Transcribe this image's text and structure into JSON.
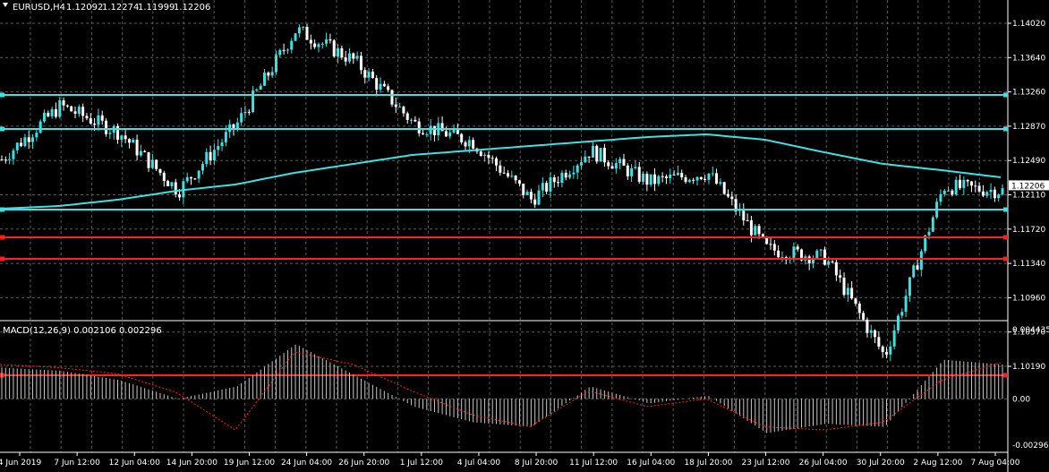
{
  "symbol_header": {
    "symbol": "EURUSD,H4",
    "open": "1.12092",
    "high": "1.12274",
    "low": "1.11999",
    "close": "1.12206"
  },
  "price_axis": {
    "labels": [
      "1.14020",
      "1.13640",
      "1.13260",
      "1.12870",
      "1.12490",
      "1.12110",
      "1.11720",
      "1.11340",
      "1.10960",
      "1.10570",
      "1.10190"
    ],
    "current_price": "1.12206"
  },
  "macd": {
    "header": "MACD(12,26,9) 0.002106 0.002296",
    "axis_labels": [
      "0.004435",
      "0.00",
      "-0.002968"
    ]
  },
  "time_axis": {
    "labels": [
      "4 Jun 2019",
      "7 Jun 12:00",
      "12 Jun 04:00",
      "14 Jun 20:00",
      "19 Jun 12:00",
      "24 Jun 04:00",
      "26 Jun 20:00",
      "1 Jul 12:00",
      "4 Jul 04:00",
      "8 Jul 20:00",
      "11 Jul 12:00",
      "16 Jul 04:00",
      "18 Jul 20:00",
      "23 Jul 12:00",
      "26 Jul 04:00",
      "30 Jul 20:00",
      "2 Aug 12:00",
      "7 Aug 04:00"
    ]
  },
  "horizontal_levels": [
    {
      "price": 1.1322,
      "color": "#40e0e0"
    },
    {
      "price": 1.1284,
      "color": "#40e0e0"
    },
    {
      "price": 1.1194,
      "color": "#40e0e0"
    },
    {
      "price": 1.1163,
      "color": "#ff2020"
    },
    {
      "price": 1.1139,
      "color": "#ff2020"
    },
    {
      "price": 1.1009,
      "color": "#ff2020"
    }
  ],
  "colors": {
    "background": "#000000",
    "grid": "#5a5a5a",
    "bull_candle": "#40e0e0",
    "bear_candle": "#ffffff",
    "moving_average": "#40e0e0",
    "macd_histogram": "#c8c8c8",
    "macd_signal": "#ff2020"
  },
  "chart_data": {
    "type": "line",
    "price_series_name": "EURUSD,H4",
    "x": [
      "4 Jun 2019",
      "7 Jun 12:00",
      "12 Jun 04:00",
      "14 Jun 20:00",
      "19 Jun 12:00",
      "24 Jun 04:00",
      "26 Jun 20:00",
      "1 Jul 12:00",
      "4 Jul 04:00",
      "8 Jul 20:00",
      "11 Jul 12:00",
      "16 Jul 04:00",
      "18 Jul 20:00",
      "23 Jul 12:00",
      "26 Jul 04:00",
      "30 Jul 20:00",
      "2 Aug 12:00",
      "7 Aug 04:00"
    ],
    "close_approx": [
      1.125,
      1.131,
      1.128,
      1.1215,
      1.129,
      1.1395,
      1.136,
      1.129,
      1.127,
      1.1205,
      1.126,
      1.1225,
      1.1235,
      1.115,
      1.114,
      1.103,
      1.122,
      1.1215
    ],
    "moving_average_approx": [
      1.1195,
      1.1198,
      1.1205,
      1.1215,
      1.1222,
      1.1235,
      1.1245,
      1.1255,
      1.126,
      1.1265,
      1.127,
      1.1275,
      1.1278,
      1.1272,
      1.1258,
      1.1245,
      1.1238,
      1.123
    ],
    "macd_histogram_approx": [
      0.002,
      0.0018,
      0.0012,
      0.0,
      0.0008,
      0.0035,
      0.0015,
      -0.0005,
      -0.0015,
      -0.0018,
      0.0008,
      -0.0003,
      0.0002,
      -0.0022,
      -0.0016,
      -0.0018,
      0.0025,
      0.0022
    ],
    "macd_signal_approx": [
      0.0022,
      0.002,
      0.0016,
      0.0004,
      -0.002,
      0.003,
      0.0022,
      0.0005,
      -0.001,
      -0.0018,
      0.0005,
      -0.0005,
      0.0,
      -0.0018,
      -0.002,
      -0.0015,
      0.0012,
      0.0023
    ],
    "ylim": [
      1.1019,
      1.1402
    ],
    "macd_ylim": [
      -0.002968,
      0.004435
    ],
    "grid": true
  }
}
